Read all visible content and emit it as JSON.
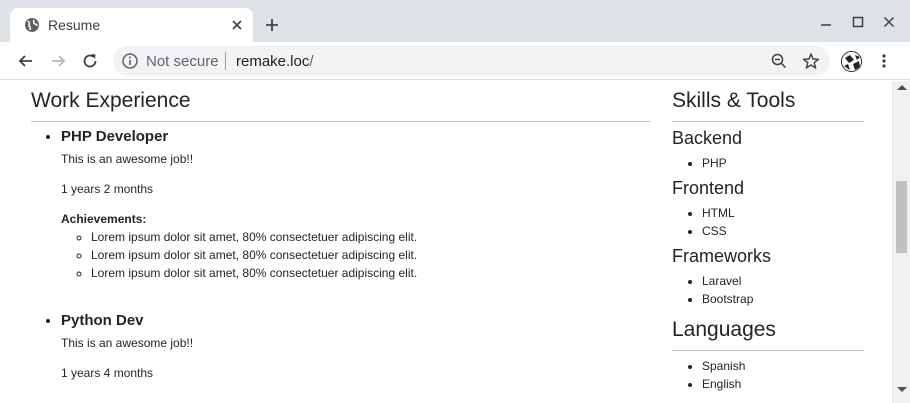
{
  "browser": {
    "tab_title": "Resume",
    "security_label": "Not secure",
    "url_host": "remake.loc",
    "url_path": "/"
  },
  "page": {
    "work_heading": "Work Experience",
    "jobs": [
      {
        "title": "PHP Developer",
        "description": "This is an awesome job!!",
        "duration": "1 years 2 months",
        "achievements_label": "Achievements:",
        "achievements": [
          "Lorem ipsum dolor sit amet, 80% consectetuer adipiscing elit.",
          "Lorem ipsum dolor sit amet, 80% consectetuer adipiscing elit.",
          "Lorem ipsum dolor sit amet, 80% consectetuer adipiscing elit."
        ]
      },
      {
        "title": "Python Dev",
        "description": "This is an awesome job!!",
        "duration": "1 years 4 months"
      }
    ],
    "skills_heading": "Skills & Tools",
    "skill_groups": [
      {
        "name": "Backend",
        "items": [
          "PHP"
        ]
      },
      {
        "name": "Frontend",
        "items": [
          "HTML",
          "CSS"
        ]
      },
      {
        "name": "Frameworks",
        "items": [
          "Laravel",
          "Bootstrap"
        ]
      }
    ],
    "languages_heading": "Languages",
    "languages": [
      "Spanish",
      "English"
    ]
  }
}
